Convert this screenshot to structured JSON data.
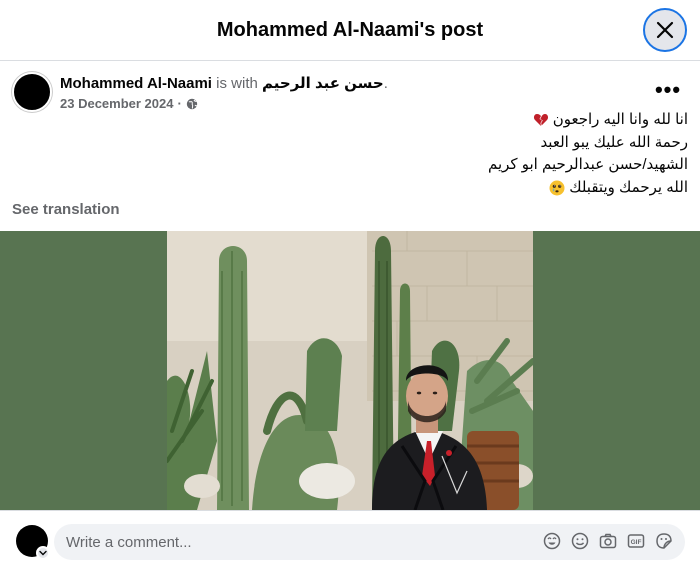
{
  "header": {
    "title": "Mohammed Al-Naami's post"
  },
  "post": {
    "author": "Mohammed Al-Naami",
    "is_with": " is with ",
    "tagged": "حسن عبد الرحيم",
    "tagged_suffix": ".",
    "date": "23 December 2024",
    "separator": "·",
    "audience_icon": "globe-icon",
    "more_label": "•••",
    "lines": [
      "انا لله وانا اليه راجعون",
      "رحمة الله عليك يبو العبد",
      "الشهيد/حسن عبدالرحيم ابو كريم",
      "الله يرحمك ويتقبلك"
    ],
    "see_translation": "See translation"
  },
  "media": {
    "background_color": "#587451",
    "description_icon": "photo"
  },
  "comment": {
    "placeholder": "Write a comment...",
    "icons": [
      "avatar-sticker-icon",
      "emoji-icon",
      "camera-icon",
      "gif-icon",
      "sticker-icon"
    ]
  },
  "colors": {
    "accent": "#1b74e4",
    "secondary_text": "#65676b",
    "input_bg": "#f0f2f5"
  }
}
